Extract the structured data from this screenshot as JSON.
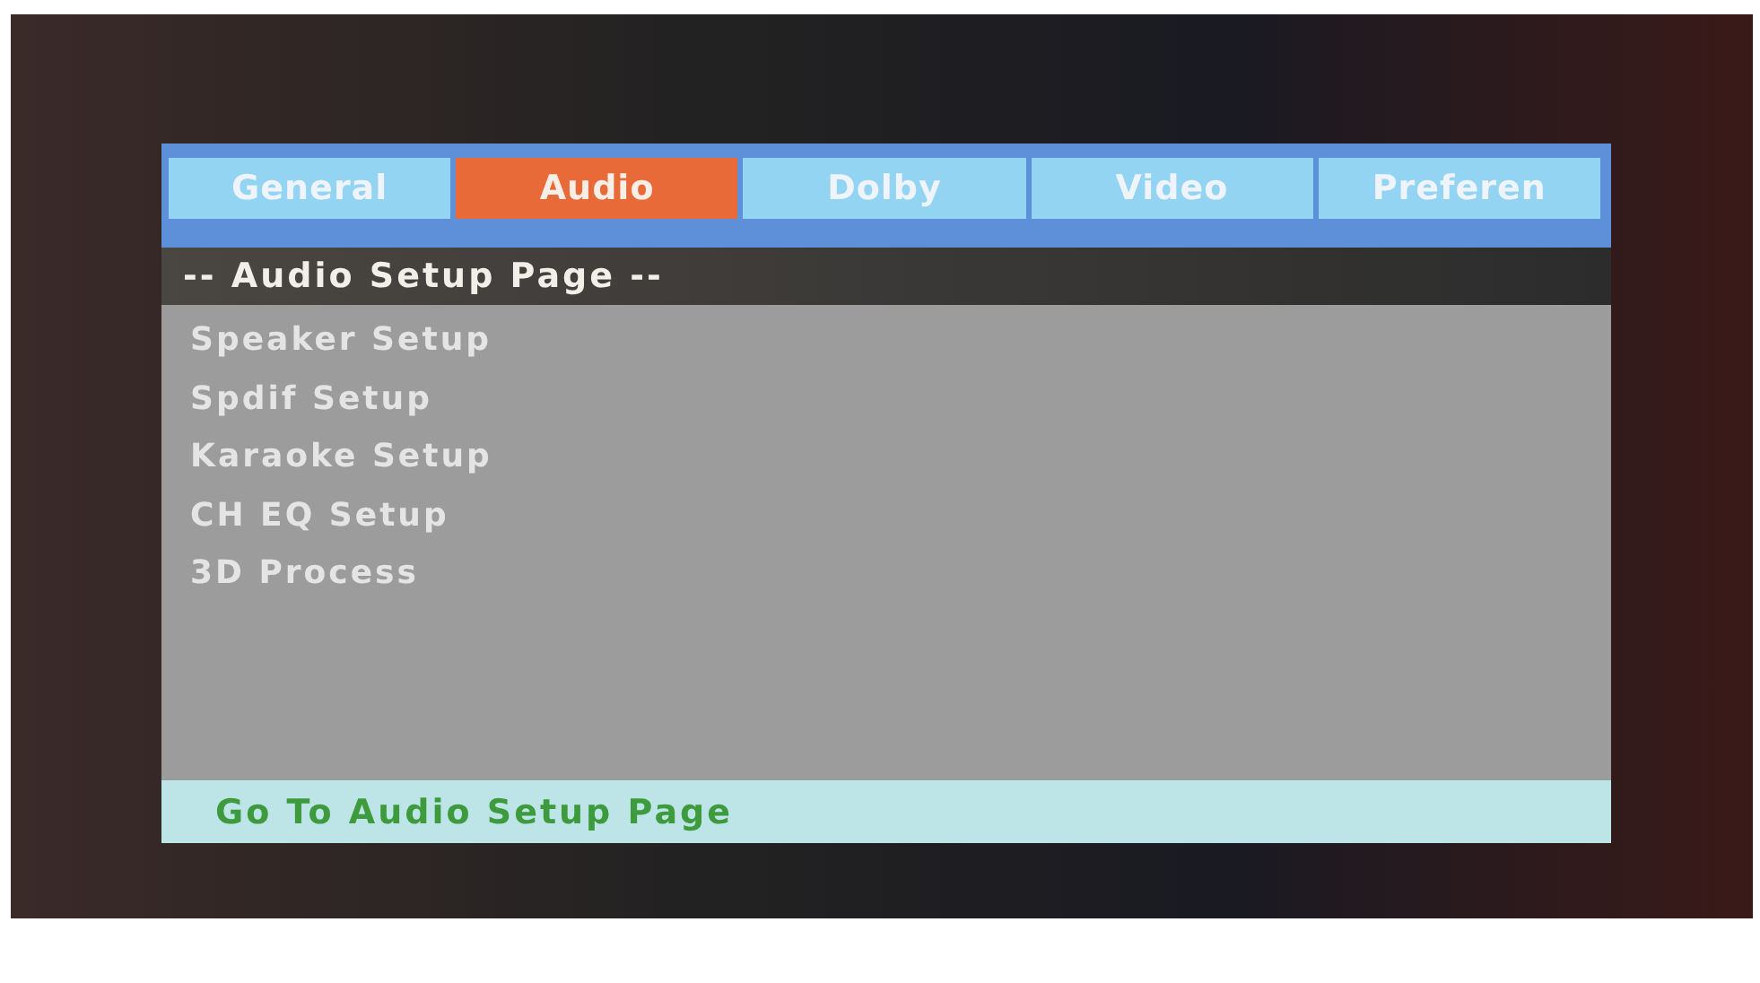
{
  "tabs": [
    {
      "label": "General",
      "selected": false
    },
    {
      "label": "Audio",
      "selected": true
    },
    {
      "label": "Dolby",
      "selected": false
    },
    {
      "label": "Video",
      "selected": false
    },
    {
      "label": "Preferen",
      "selected": false
    }
  ],
  "page_title": "-- Audio Setup Page --",
  "items": [
    "Speaker Setup",
    "Spdif Setup",
    "Karaoke Setup",
    "CH EQ Setup",
    "3D Process"
  ],
  "status_bar": "Go To Audio Setup Page"
}
